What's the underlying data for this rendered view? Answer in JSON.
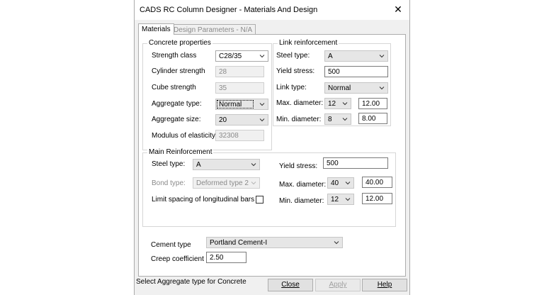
{
  "window": {
    "title": "CADS RC Column Designer - Materials And Design",
    "close_glyph": "✕"
  },
  "tabs": [
    {
      "label": "Materials",
      "active": true
    },
    {
      "label": "Design Parameters - N/A",
      "active": false
    }
  ],
  "concrete": {
    "group_label": "Concrete properties",
    "strength_class_label": "Strength class",
    "strength_class_value": "C28/35",
    "cylinder_label": "Cylinder strength",
    "cylinder_value": "28",
    "cube_label": "Cube strength",
    "cube_value": "35",
    "aggregate_type_label": "Aggregate type:",
    "aggregate_type_value": "Normal",
    "aggregate_size_label": "Aggregate size:",
    "aggregate_size_value": "20",
    "modulus_label": "Modulus of elasticity:",
    "modulus_value": "32308"
  },
  "link": {
    "group_label": "Link reinforcement",
    "steel_type_label": "Steel type:",
    "steel_type_value": "A",
    "yield_label": "Yield stress:",
    "yield_value": "500",
    "link_type_label": "Link type:",
    "link_type_value": "Normal",
    "max_dia_label": "Max. diameter:",
    "max_dia_combo": "12",
    "max_dia_value": "12.00",
    "min_dia_label": "Min. diameter:",
    "min_dia_combo": "8",
    "min_dia_value": "8.00"
  },
  "main": {
    "group_label": "Main Reinforcement",
    "steel_type_label": "Steel type:",
    "steel_type_value": "A",
    "bond_type_label": "Bond type:",
    "bond_type_value": "Deformed type 2",
    "limit_label": "Limit spacing of longitudinal bars",
    "limit_checked": false,
    "yield_label": "Yield stress:",
    "yield_value": "500",
    "max_dia_label": "Max. diameter:",
    "max_dia_combo": "40",
    "max_dia_value": "40.00",
    "min_dia_label": "Min. diameter:",
    "min_dia_combo": "12",
    "min_dia_value": "12.00"
  },
  "cement": {
    "cement_label": "Cement type",
    "cement_value": "Portland Cement-I",
    "creep_label": "Creep coefficient",
    "creep_value": "2.50"
  },
  "status_text": "Select Aggregate type for Concrete",
  "buttons": {
    "close": "Close",
    "apply": "Apply",
    "help": "Help"
  }
}
